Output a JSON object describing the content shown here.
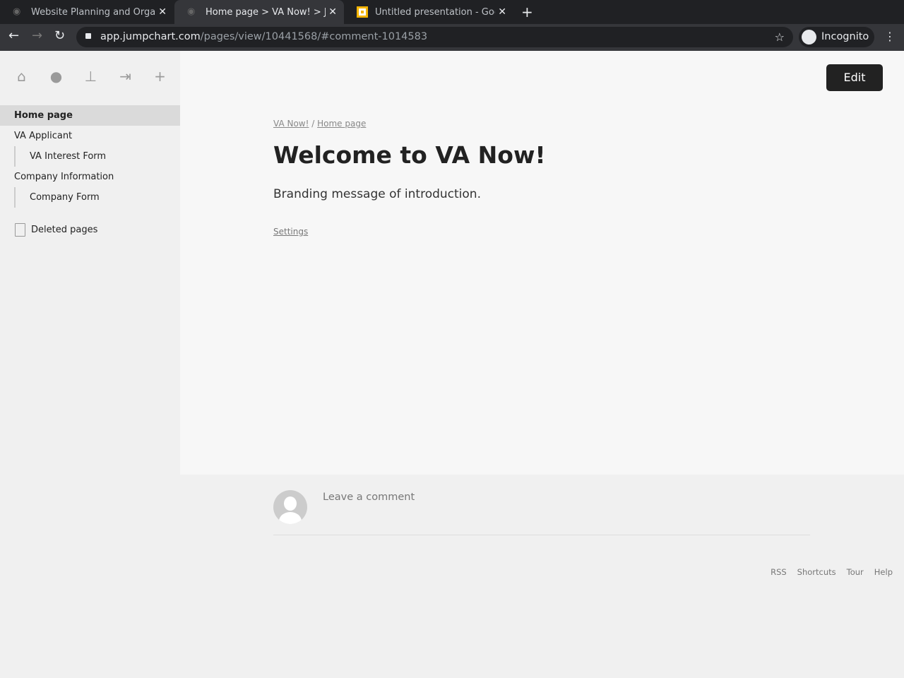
{
  "browser": {
    "tabs": [
      {
        "title": "Website Planning and Orga",
        "active": false
      },
      {
        "title": "Home page > VA Now! > Jumpchart",
        "active": true
      },
      {
        "title": "Untitled presentation - Google Slides",
        "active": false
      }
    ],
    "url_host": "app.jumpchart.com",
    "url_path": "/pages/view/10441568/#comment-1014583",
    "profile": "Incognito"
  },
  "sidebar": {
    "icons": [
      "home-icon",
      "user-icon",
      "sitemap-icon",
      "logout-icon",
      "plus-icon"
    ],
    "items": [
      {
        "label": "Home page",
        "selected": true,
        "level": 0
      },
      {
        "label": "VA Applicant",
        "level": 0
      },
      {
        "label": "VA Interest Form",
        "level": 1
      },
      {
        "label": "Company Information",
        "level": 0
      },
      {
        "label": "Company Form",
        "level": 1
      }
    ],
    "deleted": "Deleted pages"
  },
  "main": {
    "edit_label": "Edit",
    "breadcrumb": [
      "VA Now!",
      "Home page"
    ],
    "breadcrumb_sep": "/",
    "title": "Welcome to VA Now!",
    "intro": "Branding message of introduction.",
    "settings": "Settings"
  },
  "comment": {
    "placeholder": "Leave a comment"
  },
  "footer": [
    "RSS",
    "Shortcuts",
    "Tour",
    "Help"
  ]
}
